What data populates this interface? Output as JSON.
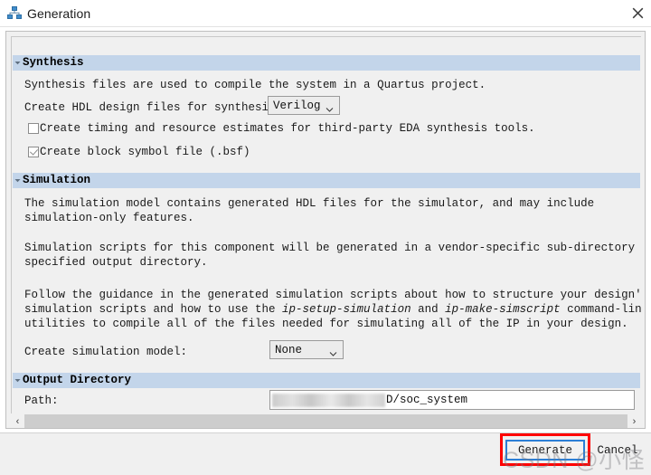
{
  "window": {
    "title": "Generation",
    "icon": "hierarchy-icon",
    "close_label": "✕"
  },
  "sections": {
    "synthesis": {
      "header": "Synthesis",
      "collapse_icon": "▾",
      "description": "Synthesis files are used to compile the system in a Quartus project.",
      "hdl_label": "Create HDL design files for synthesis:",
      "hdl_value": "Verilog",
      "checkbox_timing": {
        "label": "Create timing and resource estimates for third-party EDA synthesis tools.",
        "checked": false
      },
      "checkbox_bsf": {
        "label": "Create block symbol file (.bsf)",
        "checked": true
      }
    },
    "simulation": {
      "header": "Simulation",
      "collapse_icon": "▾",
      "paragraph1_line1": "The simulation model contains generated HDL files for the simulator, and may include",
      "paragraph1_line2": "simulation-only features.",
      "paragraph2_line1": "Simulation scripts for this component will be generated in a vendor-specific sub-directory in the",
      "paragraph2_line2": "specified output directory.",
      "paragraph3_line1_a": "Follow the guidance in the generated simulation scripts about how to structure your design's",
      "paragraph3_line2_a": "simulation scripts and how to use the ",
      "paragraph3_line2_i1": "ip-setup-simulation",
      "paragraph3_line2_b": " and ",
      "paragraph3_line2_i2": "ip-make-simscript",
      "paragraph3_line2_c": " command-line",
      "paragraph3_line3": "utilities to compile all of the files needed for simulating all of the IP in your design.",
      "model_label": "Create simulation model:",
      "model_value": "None"
    },
    "output_directory": {
      "header": "Output Directory",
      "collapse_icon": "▾",
      "path_label": "Path:",
      "path_value": "D/soc_system",
      "browse_label": "..."
    }
  },
  "scrollbar": {
    "left_arrow": "‹",
    "right_arrow": "›"
  },
  "footer": {
    "generate_label": "Generate",
    "cancel_label": "Cancel"
  },
  "annotation": {
    "highlight_target": "generate-button"
  },
  "watermark": {
    "text": "CSDN @小怪"
  },
  "colors": {
    "section_header_bg": "#c3d5ea",
    "dialog_bg": "#f0f0f0",
    "highlight": "#ff0000",
    "focus_border": "#2c7fd6"
  }
}
